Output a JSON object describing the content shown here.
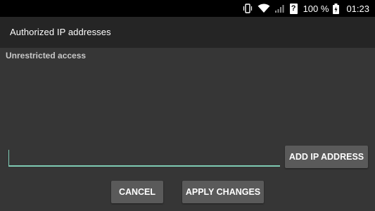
{
  "status_bar": {
    "icons": [
      "vibrate-icon",
      "wifi-icon",
      "cell-signal-icon",
      "sim-unknown-icon",
      "battery-icon"
    ],
    "sim_badge": "?",
    "battery_percent": "100 %",
    "time": "01:23"
  },
  "app_bar": {
    "title": "Authorized IP addresses"
  },
  "content": {
    "access_label": "Unrestricted access",
    "ip_input": {
      "value": "",
      "placeholder": ""
    },
    "add_button_label": "ADD IP ADDRESS",
    "cancel_button_label": "CANCEL",
    "apply_button_label": "APPLY CHANGES"
  },
  "colors": {
    "status_bar": "#000000",
    "app_bar": "#252525",
    "background": "#363636",
    "accent": "#7fcbb4",
    "button": "#5a5a5a"
  }
}
